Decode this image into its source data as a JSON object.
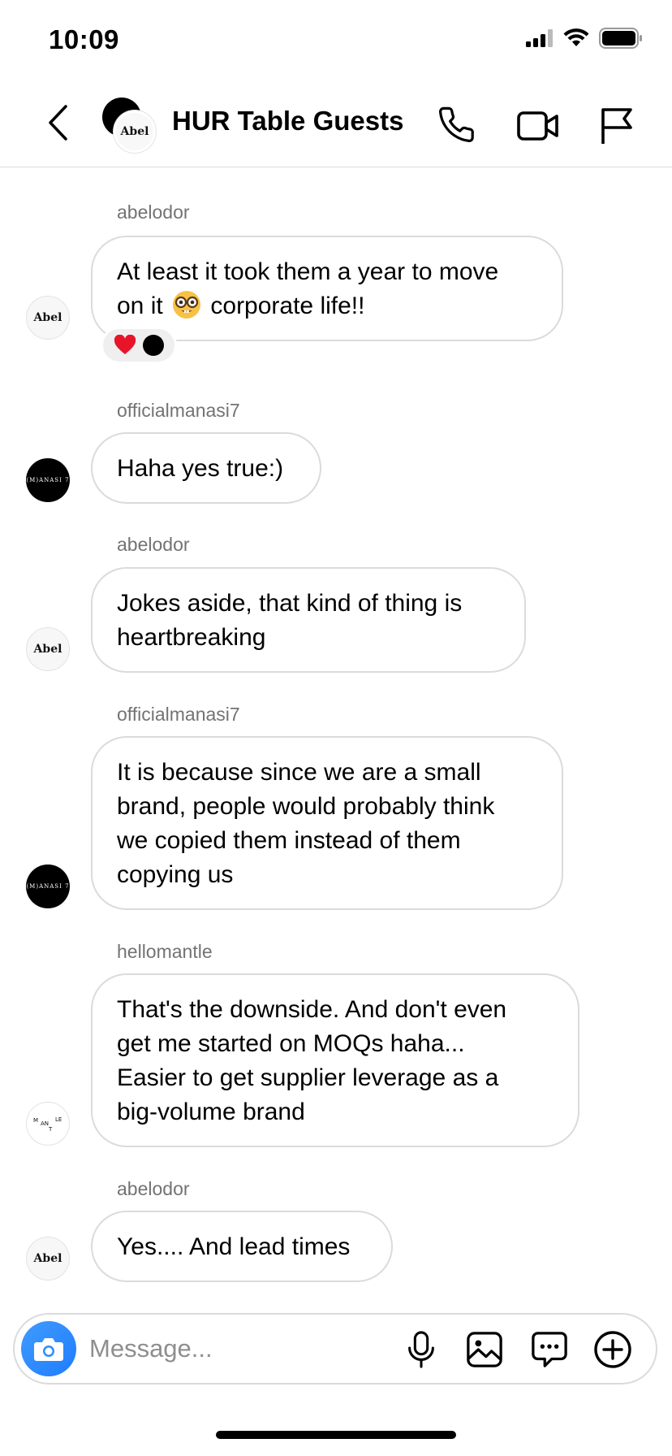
{
  "status_bar": {
    "time": "10:09"
  },
  "header": {
    "title": "HUR Table Guests"
  },
  "avatars": {
    "abel_label": "Abel",
    "manasi_label": "(M)ANASI 7"
  },
  "messages": [
    {
      "sender": "abelodor",
      "line1": "At least it took them a year to move",
      "line2a": "on it ",
      "line2b": " corporate life!!"
    },
    {
      "sender": "officialmanasi7",
      "text": "Haha yes true:)"
    },
    {
      "sender": "abelodor",
      "line1": "Jokes aside, that kind of thing is",
      "line2": "heartbreaking"
    },
    {
      "sender": "officialmanasi7",
      "lines": [
        "It is because since we are a small",
        "brand, people would probably think",
        "we copied them instead of them",
        "copying us"
      ]
    },
    {
      "sender": "hellomantle",
      "lines": [
        "That's the downside. And don't even",
        "get me started on MOQs haha...",
        "Easier to get supplier leverage as a",
        "big-volume brand"
      ]
    },
    {
      "sender": "abelodor",
      "text": "Yes.... And lead times"
    }
  ],
  "composer": {
    "placeholder": "Message..."
  },
  "colors": {
    "bubble_border": "#dbdbdb",
    "secondary_text": "#737373",
    "camera_blue": "#3f9cff"
  }
}
